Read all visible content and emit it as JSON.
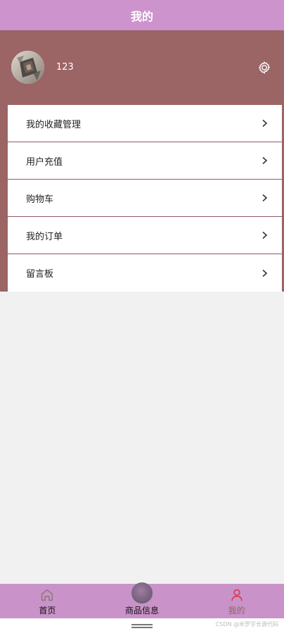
{
  "header": {
    "title": "我的"
  },
  "profile": {
    "username": "123",
    "avatar_icon": "avatar-photo",
    "settings_icon": "gear-icon"
  },
  "menu": {
    "items": [
      {
        "label": "我的收藏管理"
      },
      {
        "label": "用户充值"
      },
      {
        "label": "购物车"
      },
      {
        "label": "我的订单"
      },
      {
        "label": "留言板"
      }
    ]
  },
  "bottom_nav": {
    "items": [
      {
        "label": "首页",
        "icon": "home-icon"
      },
      {
        "label": "商品信息",
        "icon": "orb-icon"
      },
      {
        "label": "我的",
        "icon": "user-icon"
      }
    ]
  },
  "watermark": {
    "text": "CSDN @米罗学长源代码"
  },
  "colors": {
    "header": "#cd93cd",
    "profile_panel": "#9b6465",
    "menu_border": "#8d5a63",
    "nav_active": "#8b6767"
  }
}
